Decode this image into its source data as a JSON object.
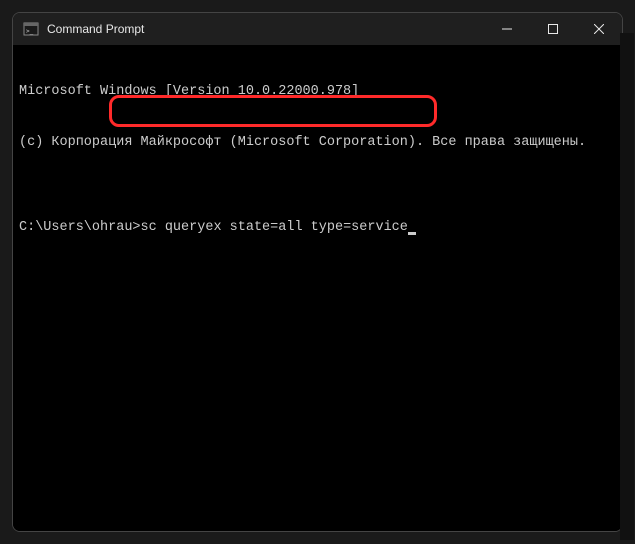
{
  "window": {
    "title": "Command Prompt"
  },
  "terminal": {
    "line1": "Microsoft Windows [Version 10.0.22000.978]",
    "line2": "(c) Корпорация Майкрософт (Microsoft Corporation). Все права защищены.",
    "blank": "",
    "prompt": "C:\\Users\\ohrau>",
    "command": "sc queryex state=all type=service"
  }
}
